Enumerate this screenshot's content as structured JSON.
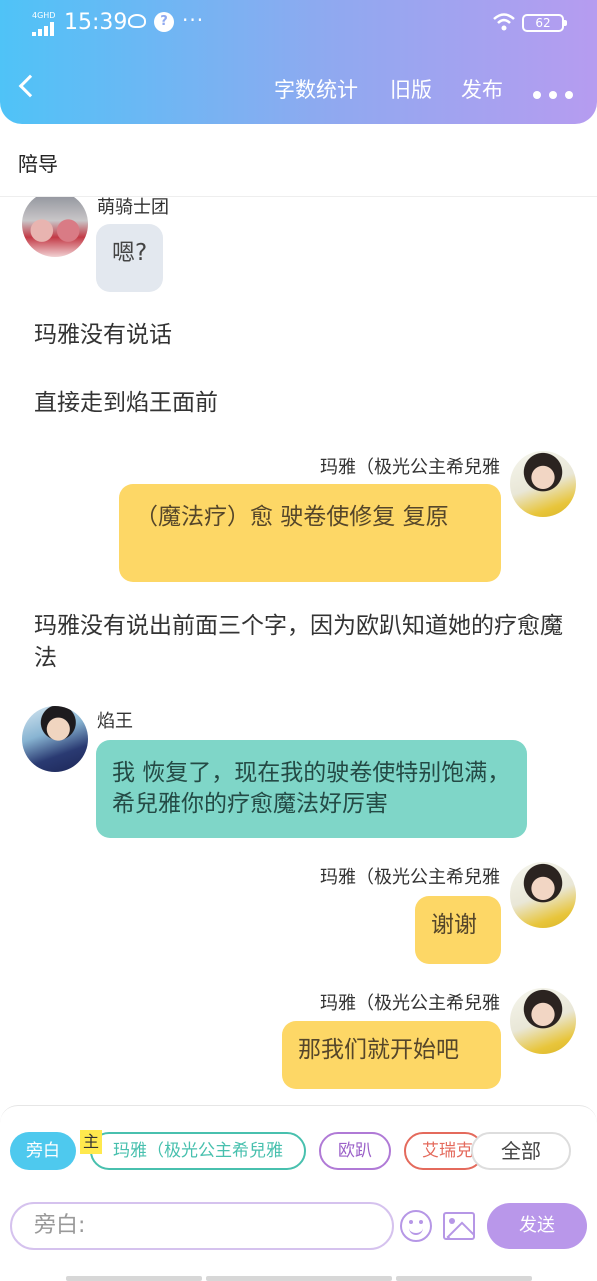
{
  "status_bar": {
    "network": "4GHD",
    "time": "15:39",
    "more": "···",
    "battery": "62"
  },
  "navbar": {
    "word_count": "字数统计",
    "old_version": "旧版",
    "publish": "发布"
  },
  "section_title": "陪导",
  "messages": [
    {
      "type": "left",
      "name": "萌骑士团",
      "text": "嗯?"
    },
    {
      "type": "narration",
      "text": "玛雅没有说话"
    },
    {
      "type": "narration",
      "text": "直接走到焰王面前"
    },
    {
      "type": "right",
      "name": "玛雅（极光公主希兒雅",
      "text": "（魔法疗）愈 驶卷使修复 复原"
    },
    {
      "type": "narration",
      "text": "玛雅没有说出前面三个字，因为欧趴知道她的疗愈魔法"
    },
    {
      "type": "left",
      "name": "焰王",
      "text": "我 恢复了，现在我的驶卷使特别饱满，希兒雅你的疗愈魔法好厉害"
    },
    {
      "type": "right",
      "name": "玛雅（极光公主希兒雅",
      "text": "谢谢"
    },
    {
      "type": "right",
      "name": "玛雅（极光公主希兒雅",
      "text": "那我们就开始吧"
    }
  ],
  "roles": {
    "narration": "旁白",
    "main_tag": "主",
    "maya": "玛雅（极光公主希兒雅",
    "ouba": "欧趴",
    "airui": "艾瑞克",
    "all": "全部"
  },
  "input": {
    "placeholder": "旁白:"
  },
  "send_label": "发送",
  "colors": {
    "accent_purple": "#b997ea",
    "bubble_yellow": "#fdd766",
    "bubble_teal": "#7fd6c8",
    "bubble_gray": "#e3e8ef",
    "header_start": "#4fc3f7",
    "header_end": "#b69cf0"
  }
}
